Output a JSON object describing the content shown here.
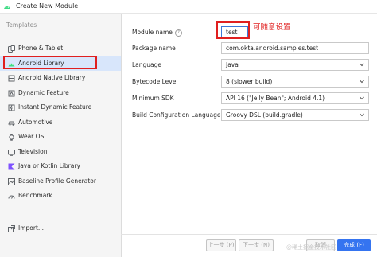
{
  "window": {
    "title": "Create New Module"
  },
  "sidebar": {
    "section_label": "Templates",
    "items": [
      {
        "label": "Phone & Tablet",
        "icon": "phone-tablet-icon"
      },
      {
        "label": "Android Library",
        "icon": "android-icon",
        "selected": true
      },
      {
        "label": "Android Native Library",
        "icon": "native-library-icon"
      },
      {
        "label": "Dynamic Feature",
        "icon": "dynamic-feature-icon"
      },
      {
        "label": "Instant Dynamic Feature",
        "icon": "instant-feature-icon"
      },
      {
        "label": "Automotive",
        "icon": "car-icon"
      },
      {
        "label": "Wear OS",
        "icon": "watch-icon"
      },
      {
        "label": "Television",
        "icon": "tv-icon"
      },
      {
        "label": "Java or Kotlin Library",
        "icon": "kotlin-icon"
      },
      {
        "label": "Baseline Profile Generator",
        "icon": "baseline-profile-icon"
      },
      {
        "label": "Benchmark",
        "icon": "benchmark-icon"
      }
    ],
    "import_label": "Import..."
  },
  "form": {
    "module_name": {
      "label": "Module name",
      "value": "test"
    },
    "package_name": {
      "label": "Package name",
      "value": "com.okta.android.samples.test"
    },
    "language": {
      "label": "Language",
      "value": "Java"
    },
    "bytecode_level": {
      "label": "Bytecode Level",
      "value": "8 (slower build)"
    },
    "minimum_sdk": {
      "label": "Minimum SDK",
      "value": "API 16 (\"Jelly Bean\"; Android 4.1)"
    },
    "build_config_language": {
      "label": "Build Configuration Language",
      "value": "Groovy DSL (build.gradle)"
    }
  },
  "annotation": {
    "text": "可随意设置"
  },
  "buttons": {
    "previous": "上一步 (P)",
    "next": "下一步 (N)",
    "cancel": "取消",
    "finish": "完成 (F)"
  },
  "watermark": "@稀土掘金技术社区",
  "colors": {
    "accent": "#3574f0",
    "selection": "#d8e6fb",
    "annotation_red": "#e01f1f",
    "android_green": "#3ddc84"
  }
}
